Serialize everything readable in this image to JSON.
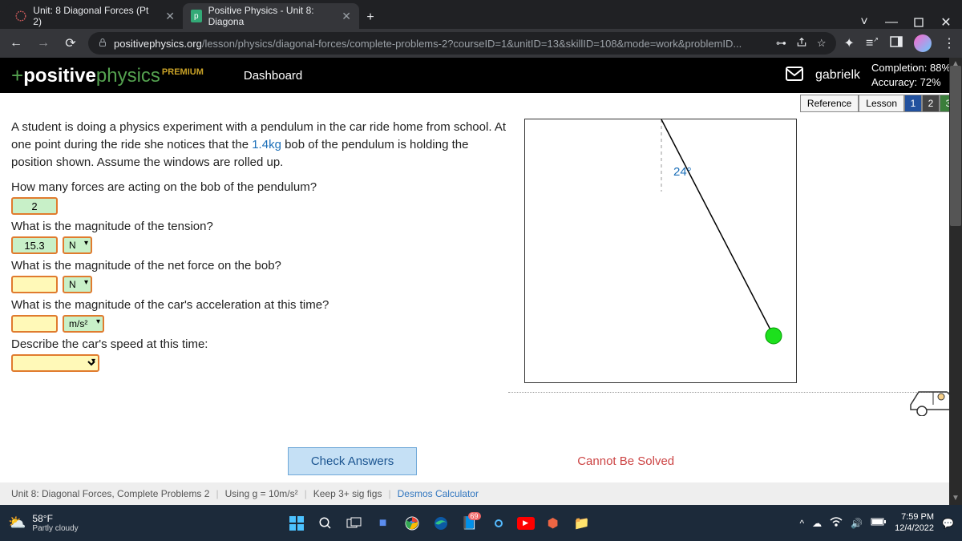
{
  "tabs": {
    "inactive": "Unit: 8 Diagonal Forces (Pt 2)",
    "active": "Positive Physics - Unit 8: Diagona"
  },
  "url": {
    "host": "positivephysics.org",
    "path": "/lesson/physics/diagonal-forces/complete-problems-2?courseID=1&unitID=13&skillID=108&mode=work&problemID..."
  },
  "header": {
    "premium": "PREMIUM",
    "dashboard": "Dashboard",
    "user": "gabrielk",
    "completion": "Completion: 88%",
    "accuracy": "Accuracy: 72%"
  },
  "nav": {
    "reference": "Reference",
    "lesson": "Lesson",
    "p1": "1",
    "p2": "2",
    "p3": "3"
  },
  "problem": {
    "intro_a": "A student is doing a physics experiment with a pendulum in the car ride home from school. At one point during the ride she notices that the ",
    "mass": "1.4kg",
    "intro_b": " bob of the pendulum is holding the position shown. Assume the windows are rolled up.",
    "q1": "How many forces are acting on the bob of the pendulum?",
    "a1": "2",
    "q2": "What is the magnitude of the tension?",
    "a2": "15.3",
    "u2": "N",
    "q3": "What is the magnitude of the net force on the bob?",
    "a3": "",
    "u3": "N",
    "q4": "What is the magnitude of the car's acceleration at this time?",
    "a4": "",
    "u4": "m/s²",
    "q5": "Describe the car's speed at this time:",
    "angle": "24°"
  },
  "buttons": {
    "check": "Check Answers",
    "cannot": "Cannot Be Solved"
  },
  "footer": {
    "unit": "Unit 8: Diagonal Forces, Complete Problems 2",
    "g": "Using g = 10m/s²",
    "sig": "Keep 3+ sig figs",
    "desmos": "Desmos Calculator"
  },
  "taskbar": {
    "temp": "58°F",
    "cond": "Partly cloudy",
    "badge": "69",
    "time": "7:59 PM",
    "date": "12/4/2022"
  }
}
